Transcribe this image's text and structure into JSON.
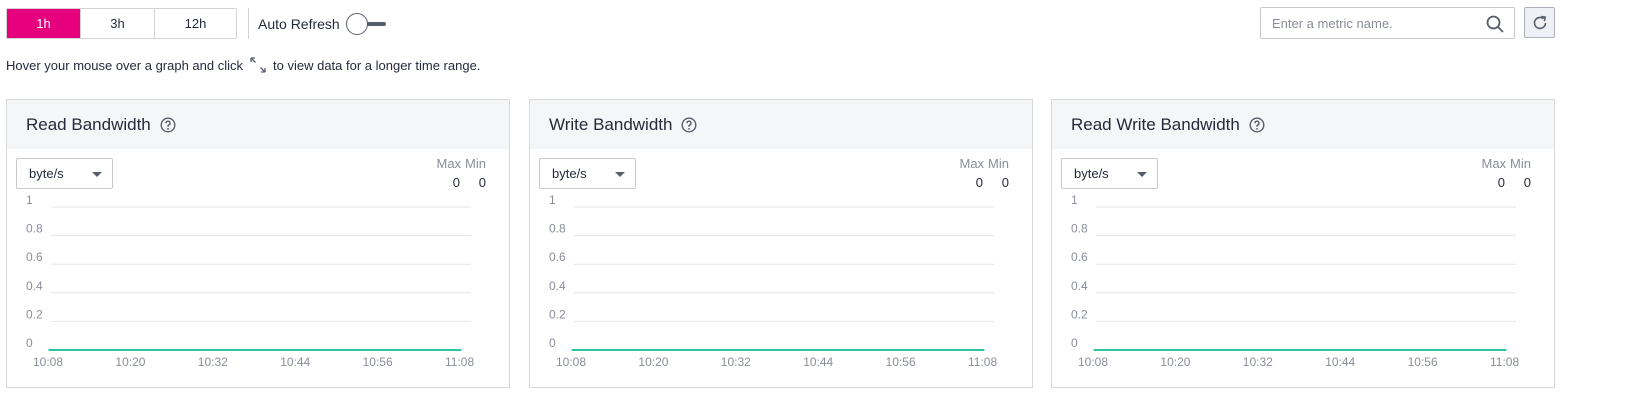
{
  "toolbar": {
    "ranges": [
      {
        "label": "1h",
        "active": true
      },
      {
        "label": "3h",
        "active": false
      },
      {
        "label": "12h",
        "active": false
      }
    ],
    "auto_refresh_label": "Auto Refresh",
    "auto_refresh_on": false
  },
  "search": {
    "placeholder": "Enter a metric name.",
    "value": ""
  },
  "hint": {
    "before": "Hover your mouse over a graph and click",
    "after": "to view data for a longer time range."
  },
  "colors": {
    "accent": "#e6007e",
    "line": "#2ec4a2",
    "grid": "#e5e5e5"
  },
  "panels": [
    {
      "title": "Read Bandwidth",
      "unit": "byte/s",
      "max_label": "Max",
      "min_label": "Min",
      "max": "0",
      "min": "0"
    },
    {
      "title": "Write Bandwidth",
      "unit": "byte/s",
      "max_label": "Max",
      "min_label": "Min",
      "max": "0",
      "min": "0"
    },
    {
      "title": "Read Write Bandwidth",
      "unit": "byte/s",
      "max_label": "Max",
      "min_label": "Min",
      "max": "0",
      "min": "0"
    }
  ],
  "chart_data": [
    {
      "type": "line",
      "x": [
        "10:08",
        "10:20",
        "10:32",
        "10:44",
        "10:56",
        "11:08"
      ],
      "series": [
        {
          "values": [
            0,
            0,
            0,
            0,
            0,
            0
          ]
        }
      ],
      "yticks": [
        "0",
        "0.2",
        "0.4",
        "0.6",
        "0.8",
        "1"
      ],
      "ylim": [
        0,
        1
      ],
      "grid": true
    },
    {
      "type": "line",
      "x": [
        "10:08",
        "10:20",
        "10:32",
        "10:44",
        "10:56",
        "11:08"
      ],
      "series": [
        {
          "values": [
            0,
            0,
            0,
            0,
            0,
            0
          ]
        }
      ],
      "yticks": [
        "0",
        "0.2",
        "0.4",
        "0.6",
        "0.8",
        "1"
      ],
      "ylim": [
        0,
        1
      ],
      "grid": true
    },
    {
      "type": "line",
      "x": [
        "10:08",
        "10:20",
        "10:32",
        "10:44",
        "10:56",
        "11:08"
      ],
      "series": [
        {
          "values": [
            0,
            0,
            0,
            0,
            0,
            0
          ]
        }
      ],
      "yticks": [
        "0",
        "0.2",
        "0.4",
        "0.6",
        "0.8",
        "1"
      ],
      "ylim": [
        0,
        1
      ],
      "grid": true
    }
  ]
}
